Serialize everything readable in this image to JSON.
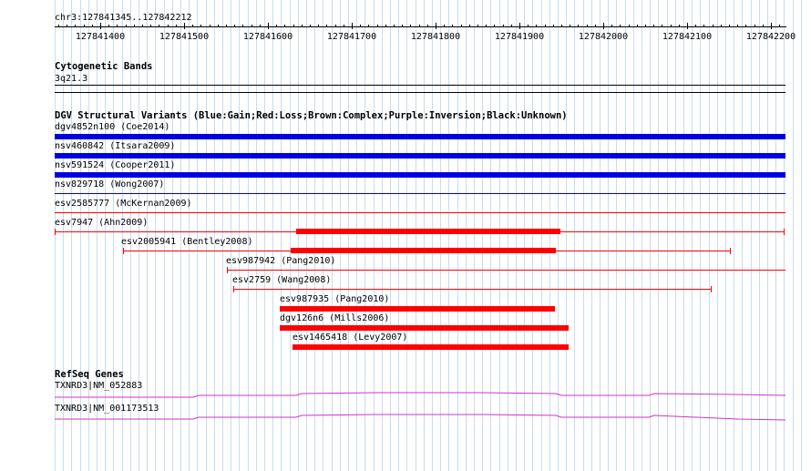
{
  "position": {
    "label": "chr3:127841345..127842212"
  },
  "ruler": {
    "ticks": [
      "127841400",
      "127841500",
      "127841600",
      "127841700",
      "127841800",
      "127841900",
      "127842000",
      "127842100",
      "127842200"
    ]
  },
  "cytoband": {
    "title": "Cytogenetic Bands",
    "band": "3q21.3"
  },
  "dgv": {
    "title": "DGV Structural Variants (Blue:Gain;Red:Loss;Brown:Complex;Purple:Inversion;Black:Unknown)",
    "colors": {
      "gain": "#0000e0",
      "loss": "#ff0000"
    },
    "variants": [
      {
        "label": "dgv4852n100 (Coe2014)",
        "type": "gain"
      },
      {
        "label": "nsv460842 (Itsara2009)",
        "type": "gain"
      },
      {
        "label": "nsv591524 (Cooper2011)",
        "type": "gain"
      },
      {
        "label": "nsv829718 (Wong2007)",
        "type": "gain"
      },
      {
        "label": "esv2585777 (McKernan2009)",
        "type": "loss"
      },
      {
        "label": "esv7947 (Ahn2009)",
        "type": "loss"
      },
      {
        "label": "esv2005941 (Bentley2008)",
        "type": "loss"
      },
      {
        "label": "esv987942 (Pang2010)",
        "type": "loss"
      },
      {
        "label": "esv2759 (Wang2008)",
        "type": "loss"
      },
      {
        "label": "esv987935 (Pang2010)",
        "type": "loss"
      },
      {
        "label": "dgv126n6 (Mills2006)",
        "type": "loss"
      },
      {
        "label": "esv1465418 (Levy2007)",
        "type": "loss"
      }
    ]
  },
  "refseq": {
    "title": "RefSeq Genes",
    "color": "#cc33cc",
    "genes": [
      {
        "label": "TXNRD3|NM_052883"
      },
      {
        "label": "TXNRD3|NM_001173513"
      }
    ]
  }
}
